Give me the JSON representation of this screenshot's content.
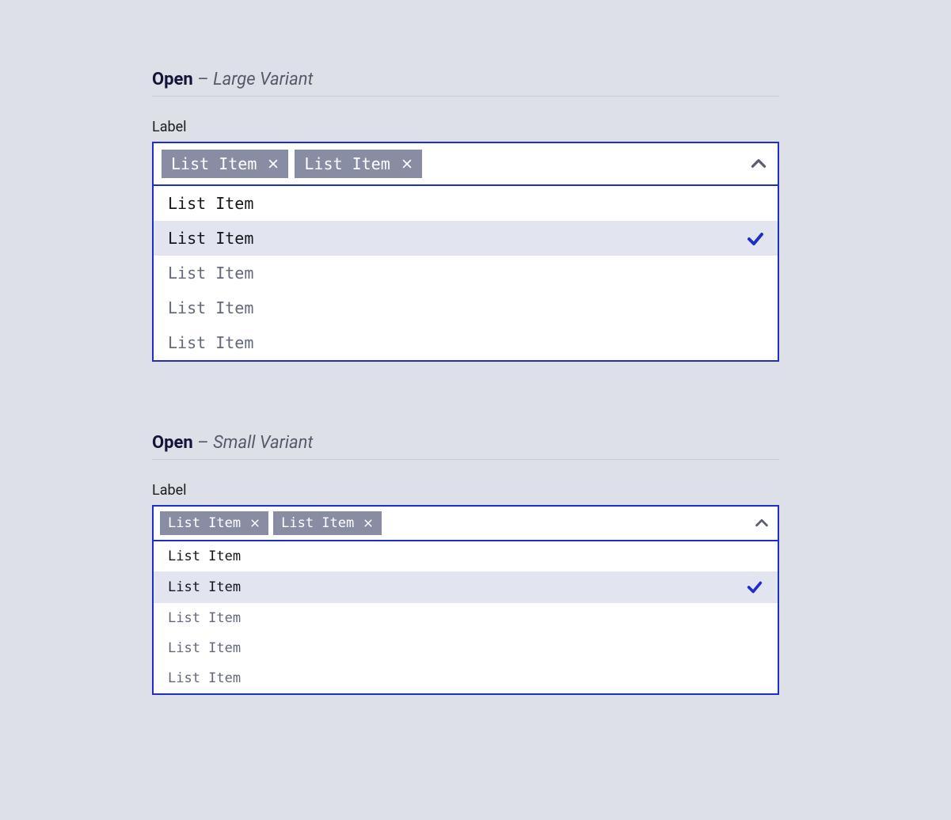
{
  "sections": [
    {
      "title_bold": "Open",
      "title_dash": " – ",
      "title_italic": "Large Variant",
      "label": "Label",
      "chips": [
        {
          "text": "List Item"
        },
        {
          "text": "List Item"
        }
      ],
      "options": [
        {
          "text": "List Item",
          "state": "dark"
        },
        {
          "text": "List Item",
          "state": "selected"
        },
        {
          "text": "List Item",
          "state": "muted"
        },
        {
          "text": "List Item",
          "state": "muted"
        },
        {
          "text": "List Item",
          "state": "muted"
        }
      ]
    },
    {
      "title_bold": "Open",
      "title_dash": " – ",
      "title_italic": "Small Variant",
      "label": "Label",
      "chips": [
        {
          "text": "List Item"
        },
        {
          "text": "List Item"
        }
      ],
      "options": [
        {
          "text": "List Item",
          "state": "dark"
        },
        {
          "text": "List Item",
          "state": "selected"
        },
        {
          "text": "List Item",
          "state": "muted"
        },
        {
          "text": "List Item",
          "state": "muted"
        },
        {
          "text": "List Item",
          "state": "muted"
        }
      ]
    }
  ]
}
